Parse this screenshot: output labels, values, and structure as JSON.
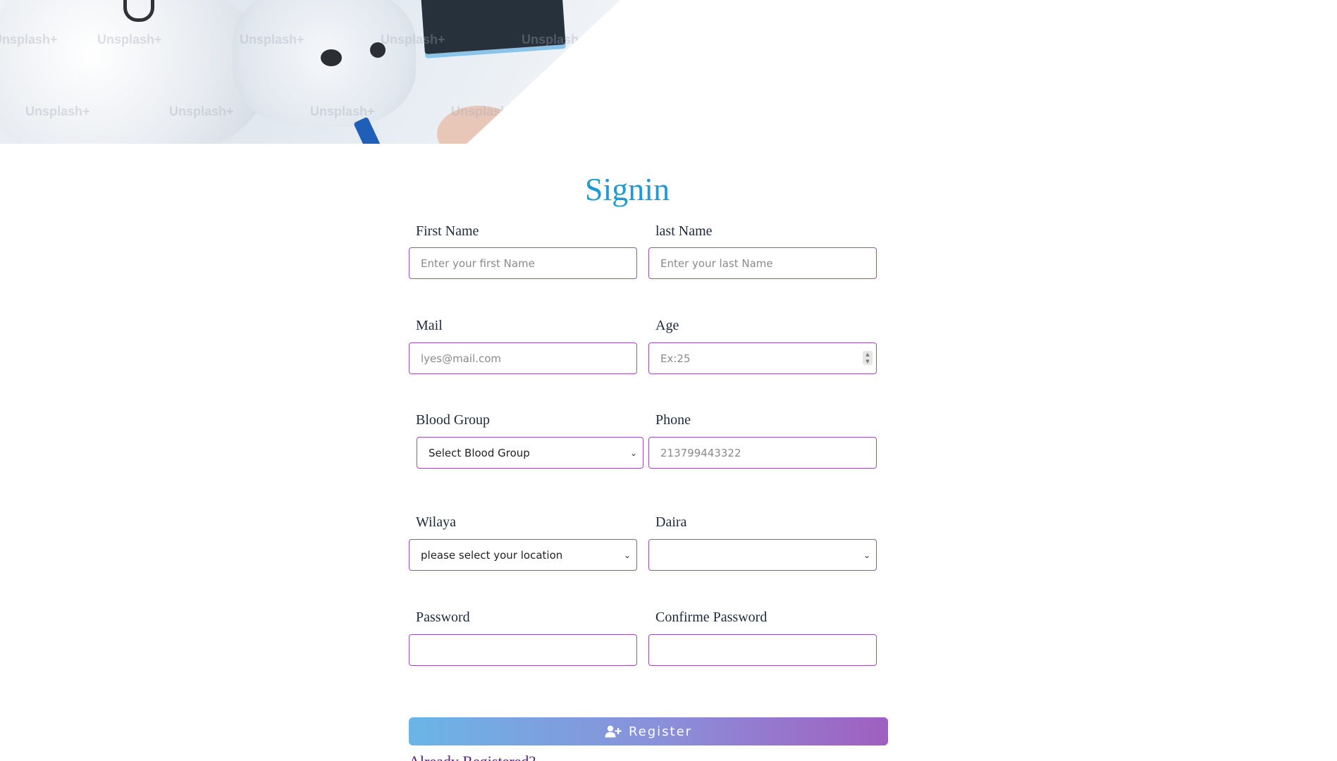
{
  "hero": {
    "watermark": "Unsplash+"
  },
  "form": {
    "title": "Signin",
    "first_name": {
      "label": "First Name",
      "placeholder": "Enter your first Name"
    },
    "last_name": {
      "label": "last Name",
      "placeholder": "Enter your last Name"
    },
    "mail": {
      "label": "Mail",
      "placeholder": "lyes@mail.com"
    },
    "age": {
      "label": "Age",
      "placeholder": "Ex:25"
    },
    "blood_group": {
      "label": "Blood Group",
      "selected": "Select Blood Group"
    },
    "phone": {
      "label": "Phone",
      "placeholder": "213799443322"
    },
    "wilaya": {
      "label": "Wilaya",
      "selected": "please select your location"
    },
    "daira": {
      "label": "Daira",
      "selected": ""
    },
    "password": {
      "label": "Password",
      "value": ""
    },
    "confirm_password": {
      "label": "Confirme Password",
      "value": ""
    },
    "register_label": "Register",
    "already_registered": "Already Registered?"
  },
  "colors": {
    "title": "#1e9ad6",
    "field_border": "#9c4fb2",
    "button_gradient_start": "#6bb5e6",
    "button_gradient_end": "#a05fbf",
    "link": "#5b1f7a"
  }
}
